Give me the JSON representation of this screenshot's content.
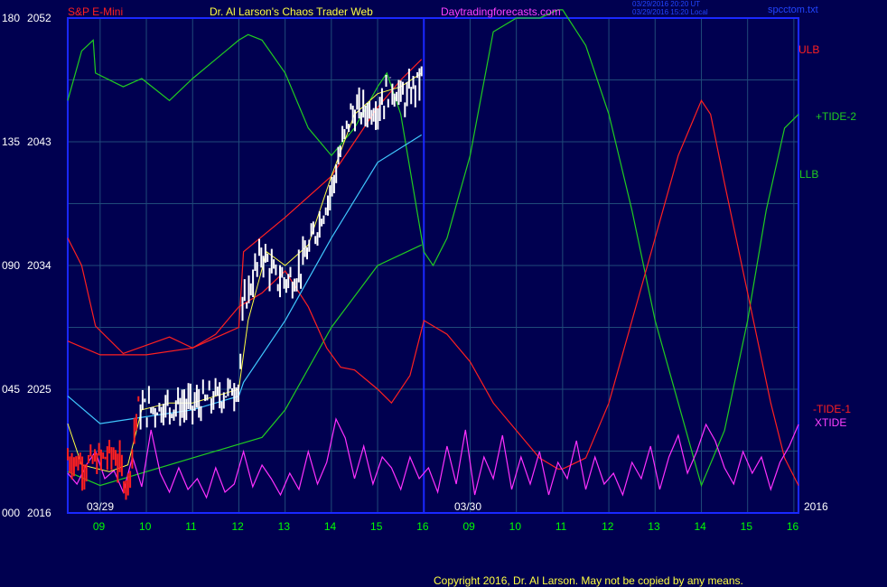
{
  "header": {
    "instrument": "S&P E-Mini",
    "title": "Dr. Al Larson's Chaos Trader Web",
    "site": "Daytradingforecasts.com",
    "stamp_ut": "03/29/2016 20:20 UT",
    "stamp_local": "03/29/2016 15:20 Local",
    "file": "spcctom.txt"
  },
  "footer": {
    "copyright": "Copyright 2016, Dr. Al Larson. May not be copied by any means."
  },
  "colors": {
    "background": "#000050",
    "frame": "#1a28ff",
    "grid": "#1f4a7a",
    "price": "#ffffff",
    "red": "#ff2020",
    "green": "#20cc20",
    "magenta": "#ff30ff",
    "cyan": "#40c8ff",
    "yellow": "#ffff40",
    "tick_green": "#00ff00"
  },
  "chart_data": {
    "type": "line",
    "title": "S&P E-Mini",
    "y_left_ticks": [
      {
        "angle": "180",
        "price": "2052"
      },
      {
        "angle": "135",
        "price": "2043"
      },
      {
        "angle": "090",
        "price": "2034"
      },
      {
        "angle": "045",
        "price": "2025"
      },
      {
        "angle": "000",
        "price": "2016"
      }
    ],
    "ylim": [
      2016,
      2052
    ],
    "x_hour_ticks": [
      "09",
      "10",
      "11",
      "12",
      "13",
      "14",
      "15",
      "16",
      "09",
      "10",
      "11",
      "12",
      "13",
      "14",
      "15",
      "16"
    ],
    "x_hours_continuous": [
      9,
      10,
      11,
      12,
      13,
      14,
      15,
      16,
      17,
      18,
      19,
      20,
      21,
      22,
      23,
      24
    ],
    "xlim": [
      8.3,
      24.1
    ],
    "day_separator_x": 16,
    "date_labels": [
      "03/29",
      "03/30"
    ],
    "year_label": "2016",
    "right_labels": [
      "ULB",
      "+TIDE-2",
      "LLB",
      "-TIDE-1",
      "XTIDE"
    ],
    "series": [
      {
        "name": "ULB",
        "color": "red",
        "x": [
          8.3,
          9,
          10,
          11,
          12,
          12.1,
          13,
          14,
          15,
          15.5,
          15.95
        ],
        "y": [
          2028.5,
          2027.5,
          2027.5,
          2028,
          2029.5,
          2035,
          2037.5,
          2040.5,
          2045.5,
          2047.5,
          2049
        ]
      },
      {
        "name": "LLB",
        "color": "green",
        "x": [
          8.3,
          9,
          10,
          11,
          12,
          12.5,
          13,
          14,
          15,
          15.95
        ],
        "y": [
          2019,
          2018,
          2019,
          2020,
          2021,
          2021.5,
          2023.5,
          2029.5,
          2034,
          2035.5
        ]
      },
      {
        "name": "+TIDE-2",
        "color": "green",
        "x": [
          8.3,
          8.6,
          8.85,
          8.9,
          9.5,
          9.9,
          10.5,
          11,
          11.5,
          12,
          12.2,
          12.5,
          13,
          13.5,
          14,
          14.5,
          15,
          15.2,
          15.5,
          16,
          16.2,
          16.5,
          17,
          17.5,
          18,
          18.5,
          18.9,
          19,
          19.5,
          20,
          20.5,
          21,
          21.5,
          22,
          22.5,
          23,
          23.4,
          23.8,
          24.1
        ],
        "y": [
          150,
          168,
          172,
          160,
          155,
          158,
          150,
          158,
          165,
          172,
          174,
          172,
          160,
          140,
          130,
          140,
          155,
          160,
          145,
          95,
          90,
          100,
          130,
          175,
          180,
          180,
          183,
          183,
          170,
          145,
          110,
          70,
          40,
          10,
          30,
          70,
          110,
          140,
          145
        ]
      },
      {
        "name": "-TIDE-1",
        "color": "red",
        "x": [
          8.3,
          8.6,
          8.9,
          9.5,
          10,
          10.5,
          11,
          11.5,
          12,
          12.5,
          13,
          13.5,
          13.9,
          14.2,
          14.5,
          15,
          15.3,
          15.7,
          16,
          16.5,
          17,
          17.5,
          18,
          18.5,
          18.9,
          19,
          19.5,
          20,
          20.5,
          21,
          21.5,
          22,
          22.2,
          22.5,
          23,
          23.5,
          23.8,
          24.1
        ],
        "y": [
          100,
          90,
          68,
          58,
          61,
          64,
          60,
          65,
          75,
          80,
          88,
          75,
          60,
          53,
          52,
          45,
          40,
          50,
          70,
          65,
          55,
          40,
          30,
          20,
          16,
          16,
          20,
          40,
          70,
          100,
          130,
          150,
          145,
          120,
          80,
          40,
          20,
          10
        ]
      },
      {
        "name": "XTIDE",
        "color": "magenta",
        "x": [
          8.3,
          8.5,
          8.7,
          8.9,
          9.1,
          9.3,
          9.5,
          9.7,
          9.9,
          10.1,
          10.3,
          10.5,
          10.7,
          10.9,
          11.1,
          11.3,
          11.5,
          11.7,
          11.9,
          12.1,
          12.3,
          12.5,
          12.7,
          12.9,
          13.1,
          13.3,
          13.5,
          13.7,
          13.9,
          14.1,
          14.3,
          14.5,
          14.7,
          14.9,
          15.1,
          15.3,
          15.5,
          15.7,
          15.9,
          16.1,
          16.3,
          16.5,
          16.7,
          16.9,
          17.1,
          17.3,
          17.5,
          17.7,
          17.9,
          18.1,
          18.3,
          18.5,
          18.7,
          18.9,
          19.1,
          19.3,
          19.5,
          19.7,
          19.9,
          20.1,
          20.3,
          20.5,
          20.7,
          20.9,
          21.1,
          21.3,
          21.5,
          21.7,
          21.9,
          22.1,
          22.3,
          22.5,
          22.7,
          22.9,
          23.1,
          23.3,
          23.5,
          23.7,
          23.9,
          24.1
        ],
        "y": [
          12,
          8,
          15,
          20,
          10,
          13,
          5,
          18,
          7,
          28,
          12,
          5,
          14,
          6,
          10,
          3,
          14,
          5,
          8,
          20,
          7,
          15,
          10,
          4,
          12,
          6,
          20,
          8,
          16,
          32,
          25,
          10,
          22,
          8,
          18,
          14,
          6,
          18,
          10,
          14,
          5,
          22,
          8,
          28,
          4,
          18,
          10,
          26,
          6,
          18,
          8,
          20,
          4,
          16,
          10,
          24,
          6,
          18,
          8,
          12,
          4,
          16,
          10,
          22,
          6,
          18,
          26,
          12,
          20,
          30,
          24,
          14,
          8,
          20,
          12,
          18,
          6,
          16,
          22,
          30
        ]
      }
    ],
    "price_bars_note": "white 5-minute price bars (03/29 session), red early bars"
  }
}
